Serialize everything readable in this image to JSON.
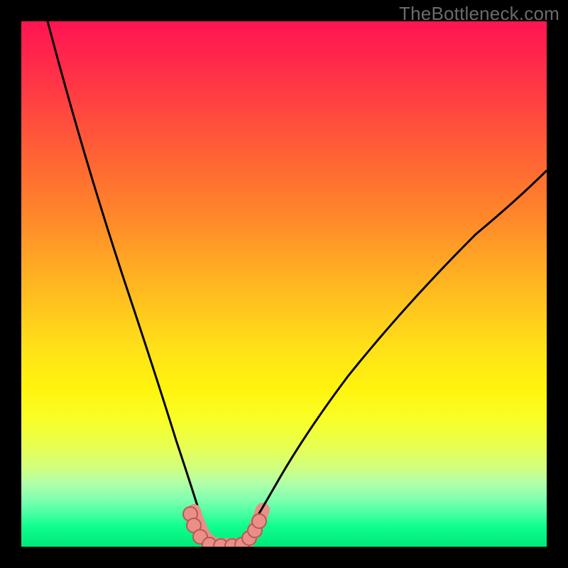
{
  "watermark": "TheBottleneck.com",
  "colors": {
    "frame": "#000000",
    "gradient_top": "#ff1452",
    "gradient_bottom": "#00e878",
    "curve": "#000000",
    "dots_fill": "#e98f87",
    "dots_stroke": "#b55a52"
  },
  "chart_data": {
    "type": "line",
    "title": "",
    "xlabel": "",
    "ylabel": "",
    "xlim": [
      0,
      100
    ],
    "ylim": [
      0,
      100
    ],
    "left_curve": {
      "x": [
        5,
        8,
        12,
        16,
        20,
        24,
        27,
        29,
        31,
        33,
        34.5,
        36
      ],
      "y": [
        100,
        88,
        74,
        60,
        46,
        32,
        21,
        14,
        8,
        4,
        1.5,
        0
      ]
    },
    "right_curve": {
      "x": [
        42,
        44,
        47,
        51,
        56,
        62,
        70,
        80,
        92,
        100
      ],
      "y": [
        0,
        2,
        6,
        12,
        20,
        29,
        40,
        52,
        64,
        71.5
      ]
    },
    "flat_segment": {
      "x": [
        36,
        42
      ],
      "y": [
        0,
        0
      ]
    },
    "dots": [
      {
        "x": 32.2,
        "y": 6.2
      },
      {
        "x": 32.9,
        "y": 4.0
      },
      {
        "x": 34.0,
        "y": 1.6
      },
      {
        "x": 35.8,
        "y": 0.2
      },
      {
        "x": 38.0,
        "y": 0.0
      },
      {
        "x": 40.2,
        "y": 0.0
      },
      {
        "x": 42.0,
        "y": 0.3
      },
      {
        "x": 43.4,
        "y": 1.5
      },
      {
        "x": 44.4,
        "y": 3.1
      },
      {
        "x": 45.2,
        "y": 4.9
      }
    ],
    "note": "Axes are implicit (no tick labels shown). y=0 is at the bottom green band; y=100 is top red. x=0 at left edge of gradient, x=100 at right edge."
  }
}
